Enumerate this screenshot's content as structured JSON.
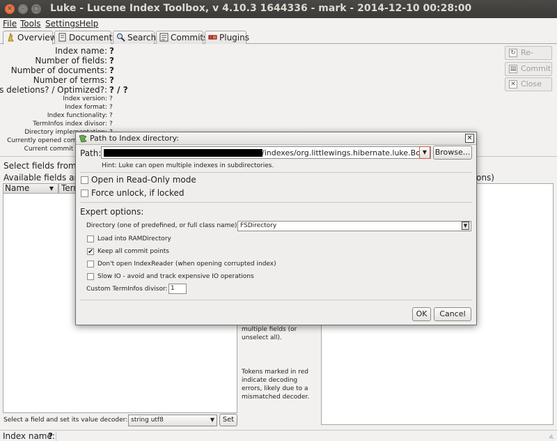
{
  "window": {
    "title": "Luke - Lucene Index Toolbox, v 4.10.3 1644336 - mark - 2014-12-10 00:28:00"
  },
  "menu": [
    "File",
    "Tools",
    "Settings",
    "Help"
  ],
  "tabs": [
    "Overview",
    "Documents",
    "Search",
    "Commits",
    "Plugins"
  ],
  "overview": {
    "index_name": {
      "label": "Index name:",
      "value": "?"
    },
    "num_fields": {
      "label": "Number of fields:",
      "value": "?"
    },
    "num_docs": {
      "label": "Number of documents:",
      "value": "?"
    },
    "num_terms": {
      "label": "Number of terms:",
      "value": "?"
    },
    "deletions": {
      "label": "Has deletions? / Optimized?:",
      "value": "? / ?"
    },
    "index_version": {
      "label": "Index version:",
      "value": "?"
    },
    "index_format": {
      "label": "Index format:",
      "value": "?"
    },
    "index_functionality": {
      "label": "Index functionality:",
      "value": "?"
    },
    "terminfos_divisor": {
      "label": "TermInfos index divisor:",
      "value": "?"
    },
    "directory_impl": {
      "label": "Directory implementation:",
      "value": "?"
    },
    "currently_opened": {
      "label": "Currently opened commit point:",
      "value": "?"
    },
    "current_commit": {
      "label": "Current commit user data:",
      "value": "?"
    }
  },
  "side_buttons": {
    "reopen": "Re-open",
    "commit": "Commit",
    "close": "Close"
  },
  "fields_section": {
    "select_fields": "Select fields from the list below",
    "available_fields": "Available fields and term counts per field:",
    "name_col": "Name",
    "term_col": "Term",
    "right_header_tail": "ons)"
  },
  "mid_help": {
    "text1": "multiple fields (or unselect all).",
    "text2": "Tokens marked in red indicate decoding errors, likely due to a mismatched decoder."
  },
  "decoder": {
    "label": "Select a field and set its value decoder:",
    "value": "string utf8",
    "set": "Set"
  },
  "status": {
    "label": "Index name:",
    "value": "?"
  },
  "dialog": {
    "title": "Path to Index directory:",
    "path_label": "Path:",
    "path_value": "/indexes/org.littlewings.hibernate.luke.Book",
    "browse": "Browse...",
    "hint": "Hint: Luke can open multiple indexes in subdirectories.",
    "readonly": "Open in Read-Only mode",
    "force_unlock": "Force unlock, if locked",
    "expert": "Expert options:",
    "directory_label": "Directory (one of predefined, or full class name):",
    "directory_value": "FSDirectory",
    "load_ram": "Load into RAMDirectory",
    "keep_commits": "Keep all commit points",
    "dont_open": "Don't open IndexReader (when opening corrupted index)",
    "slow_io": "Slow IO - avoid and track expensive IO operations",
    "custom_divisor_label": "Custom TermInfos divisor:",
    "custom_divisor_value": "1",
    "ok": "OK",
    "cancel": "Cancel"
  }
}
